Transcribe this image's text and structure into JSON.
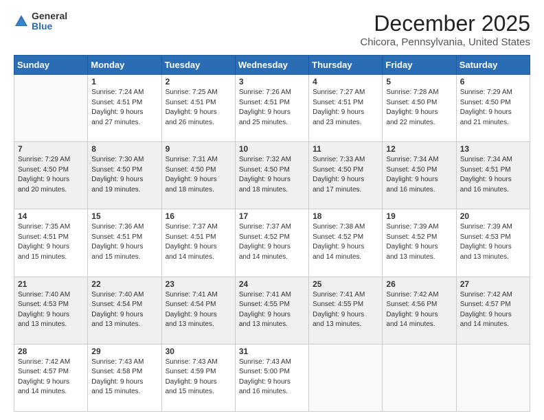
{
  "header": {
    "logo": {
      "line1": "General",
      "line2": "Blue"
    },
    "title": "December 2025",
    "subtitle": "Chicora, Pennsylvania, United States"
  },
  "weekdays": [
    "Sunday",
    "Monday",
    "Tuesday",
    "Wednesday",
    "Thursday",
    "Friday",
    "Saturday"
  ],
  "weeks": [
    [
      {
        "day": "",
        "info": ""
      },
      {
        "day": "1",
        "info": "Sunrise: 7:24 AM\nSunset: 4:51 PM\nDaylight: 9 hours\nand 27 minutes."
      },
      {
        "day": "2",
        "info": "Sunrise: 7:25 AM\nSunset: 4:51 PM\nDaylight: 9 hours\nand 26 minutes."
      },
      {
        "day": "3",
        "info": "Sunrise: 7:26 AM\nSunset: 4:51 PM\nDaylight: 9 hours\nand 25 minutes."
      },
      {
        "day": "4",
        "info": "Sunrise: 7:27 AM\nSunset: 4:51 PM\nDaylight: 9 hours\nand 23 minutes."
      },
      {
        "day": "5",
        "info": "Sunrise: 7:28 AM\nSunset: 4:50 PM\nDaylight: 9 hours\nand 22 minutes."
      },
      {
        "day": "6",
        "info": "Sunrise: 7:29 AM\nSunset: 4:50 PM\nDaylight: 9 hours\nand 21 minutes."
      }
    ],
    [
      {
        "day": "7",
        "info": "Sunrise: 7:29 AM\nSunset: 4:50 PM\nDaylight: 9 hours\nand 20 minutes."
      },
      {
        "day": "8",
        "info": "Sunrise: 7:30 AM\nSunset: 4:50 PM\nDaylight: 9 hours\nand 19 minutes."
      },
      {
        "day": "9",
        "info": "Sunrise: 7:31 AM\nSunset: 4:50 PM\nDaylight: 9 hours\nand 18 minutes."
      },
      {
        "day": "10",
        "info": "Sunrise: 7:32 AM\nSunset: 4:50 PM\nDaylight: 9 hours\nand 18 minutes."
      },
      {
        "day": "11",
        "info": "Sunrise: 7:33 AM\nSunset: 4:50 PM\nDaylight: 9 hours\nand 17 minutes."
      },
      {
        "day": "12",
        "info": "Sunrise: 7:34 AM\nSunset: 4:50 PM\nDaylight: 9 hours\nand 16 minutes."
      },
      {
        "day": "13",
        "info": "Sunrise: 7:34 AM\nSunset: 4:51 PM\nDaylight: 9 hours\nand 16 minutes."
      }
    ],
    [
      {
        "day": "14",
        "info": "Sunrise: 7:35 AM\nSunset: 4:51 PM\nDaylight: 9 hours\nand 15 minutes."
      },
      {
        "day": "15",
        "info": "Sunrise: 7:36 AM\nSunset: 4:51 PM\nDaylight: 9 hours\nand 15 minutes."
      },
      {
        "day": "16",
        "info": "Sunrise: 7:37 AM\nSunset: 4:51 PM\nDaylight: 9 hours\nand 14 minutes."
      },
      {
        "day": "17",
        "info": "Sunrise: 7:37 AM\nSunset: 4:52 PM\nDaylight: 9 hours\nand 14 minutes."
      },
      {
        "day": "18",
        "info": "Sunrise: 7:38 AM\nSunset: 4:52 PM\nDaylight: 9 hours\nand 14 minutes."
      },
      {
        "day": "19",
        "info": "Sunrise: 7:39 AM\nSunset: 4:52 PM\nDaylight: 9 hours\nand 13 minutes."
      },
      {
        "day": "20",
        "info": "Sunrise: 7:39 AM\nSunset: 4:53 PM\nDaylight: 9 hours\nand 13 minutes."
      }
    ],
    [
      {
        "day": "21",
        "info": "Sunrise: 7:40 AM\nSunset: 4:53 PM\nDaylight: 9 hours\nand 13 minutes."
      },
      {
        "day": "22",
        "info": "Sunrise: 7:40 AM\nSunset: 4:54 PM\nDaylight: 9 hours\nand 13 minutes."
      },
      {
        "day": "23",
        "info": "Sunrise: 7:41 AM\nSunset: 4:54 PM\nDaylight: 9 hours\nand 13 minutes."
      },
      {
        "day": "24",
        "info": "Sunrise: 7:41 AM\nSunset: 4:55 PM\nDaylight: 9 hours\nand 13 minutes."
      },
      {
        "day": "25",
        "info": "Sunrise: 7:41 AM\nSunset: 4:55 PM\nDaylight: 9 hours\nand 13 minutes."
      },
      {
        "day": "26",
        "info": "Sunrise: 7:42 AM\nSunset: 4:56 PM\nDaylight: 9 hours\nand 14 minutes."
      },
      {
        "day": "27",
        "info": "Sunrise: 7:42 AM\nSunset: 4:57 PM\nDaylight: 9 hours\nand 14 minutes."
      }
    ],
    [
      {
        "day": "28",
        "info": "Sunrise: 7:42 AM\nSunset: 4:57 PM\nDaylight: 9 hours\nand 14 minutes."
      },
      {
        "day": "29",
        "info": "Sunrise: 7:43 AM\nSunset: 4:58 PM\nDaylight: 9 hours\nand 15 minutes."
      },
      {
        "day": "30",
        "info": "Sunrise: 7:43 AM\nSunset: 4:59 PM\nDaylight: 9 hours\nand 15 minutes."
      },
      {
        "day": "31",
        "info": "Sunrise: 7:43 AM\nSunset: 5:00 PM\nDaylight: 9 hours\nand 16 minutes."
      },
      {
        "day": "",
        "info": ""
      },
      {
        "day": "",
        "info": ""
      },
      {
        "day": "",
        "info": ""
      }
    ]
  ]
}
